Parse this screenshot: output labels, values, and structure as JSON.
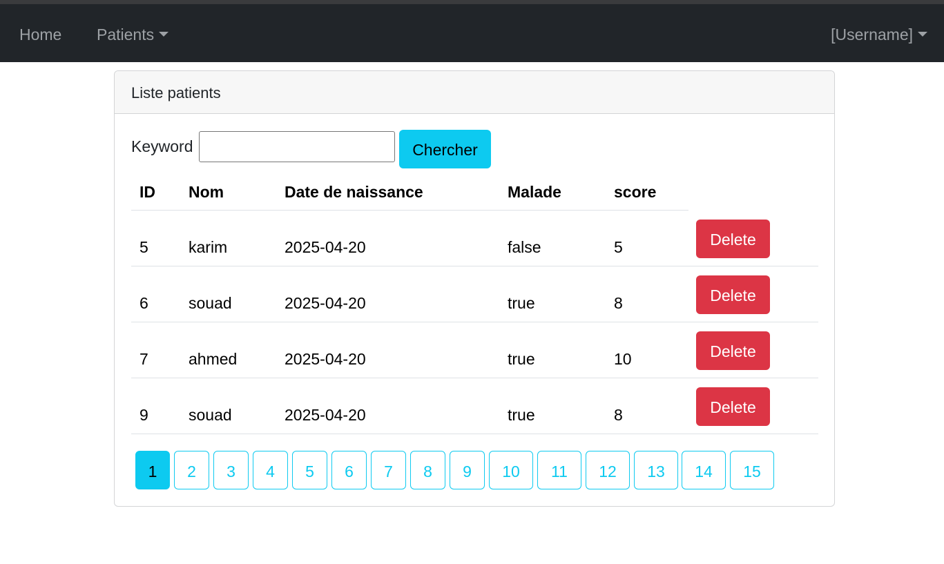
{
  "navbar": {
    "home_label": "Home",
    "patients_label": "Patients",
    "user_label": "[Username]"
  },
  "card": {
    "title": "Liste patients"
  },
  "search": {
    "label": "Keyword",
    "value": "",
    "placeholder": "",
    "button_label": "Chercher"
  },
  "table": {
    "headers": [
      "ID",
      "Nom",
      "Date de naissance",
      "Malade",
      "score"
    ],
    "rows": [
      {
        "id": "5",
        "nom": "karim",
        "date": "2025-04-20",
        "malade": "false",
        "score": "5",
        "action": "Delete"
      },
      {
        "id": "6",
        "nom": "souad",
        "date": "2025-04-20",
        "malade": "true",
        "score": "8",
        "action": "Delete"
      },
      {
        "id": "7",
        "nom": "ahmed",
        "date": "2025-04-20",
        "malade": "true",
        "score": "10",
        "action": "Delete"
      },
      {
        "id": "9",
        "nom": "souad",
        "date": "2025-04-20",
        "malade": "true",
        "score": "8",
        "action": "Delete"
      }
    ]
  },
  "pagination": {
    "pages": [
      "1",
      "2",
      "3",
      "4",
      "5",
      "6",
      "7",
      "8",
      "9",
      "10",
      "11",
      "12",
      "13",
      "14",
      "15"
    ],
    "current": "1"
  },
  "colors": {
    "navbar_bg": "#212529",
    "accent": "#0dcaf0",
    "danger": "#dc3545"
  }
}
